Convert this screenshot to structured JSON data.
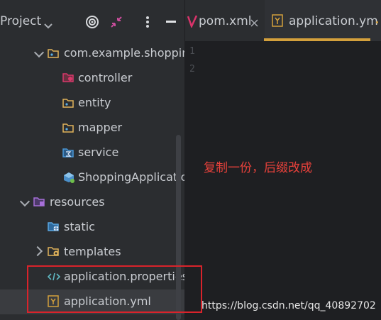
{
  "header": {
    "project_label": "Project",
    "icons": [
      "target-icon",
      "collapse-icon",
      "more-icon",
      "minimize-icon"
    ]
  },
  "tabs": [
    {
      "label": "pom.xml",
      "icon": "maven-icon",
      "active": false
    },
    {
      "label": "application.ym",
      "icon": "yaml-icon",
      "active": true
    }
  ],
  "tree": {
    "items": [
      {
        "label": "com.example.shopping",
        "icon": "package-icon",
        "expanded": true
      },
      {
        "label": "controller",
        "icon": "folder-icon"
      },
      {
        "label": "entity",
        "icon": "folder-icon"
      },
      {
        "label": "mapper",
        "icon": "folder-icon"
      },
      {
        "label": "service",
        "icon": "folder-icon"
      },
      {
        "label": "ShoppingApplicatio",
        "icon": "spring-class-icon"
      },
      {
        "label": "resources",
        "icon": "resources-folder-icon",
        "expanded": true
      },
      {
        "label": "static",
        "icon": "web-folder-icon"
      },
      {
        "label": "templates",
        "icon": "templates-folder-icon",
        "expanded": false
      },
      {
        "label": "application.properties",
        "icon": "properties-file-icon"
      },
      {
        "label": "application.yml",
        "icon": "yaml-file-icon",
        "selected": true
      }
    ]
  },
  "editor": {
    "line_numbers": [
      "1",
      "2"
    ]
  },
  "annotation": {
    "note": "复制一份，后缀改成",
    "watermark": "https://blog.csdn.net/qq_40892702"
  },
  "colors": {
    "accent_tab": "#d3a03c",
    "annotation_red": "#e8413b",
    "selection": "#3a3c40"
  }
}
